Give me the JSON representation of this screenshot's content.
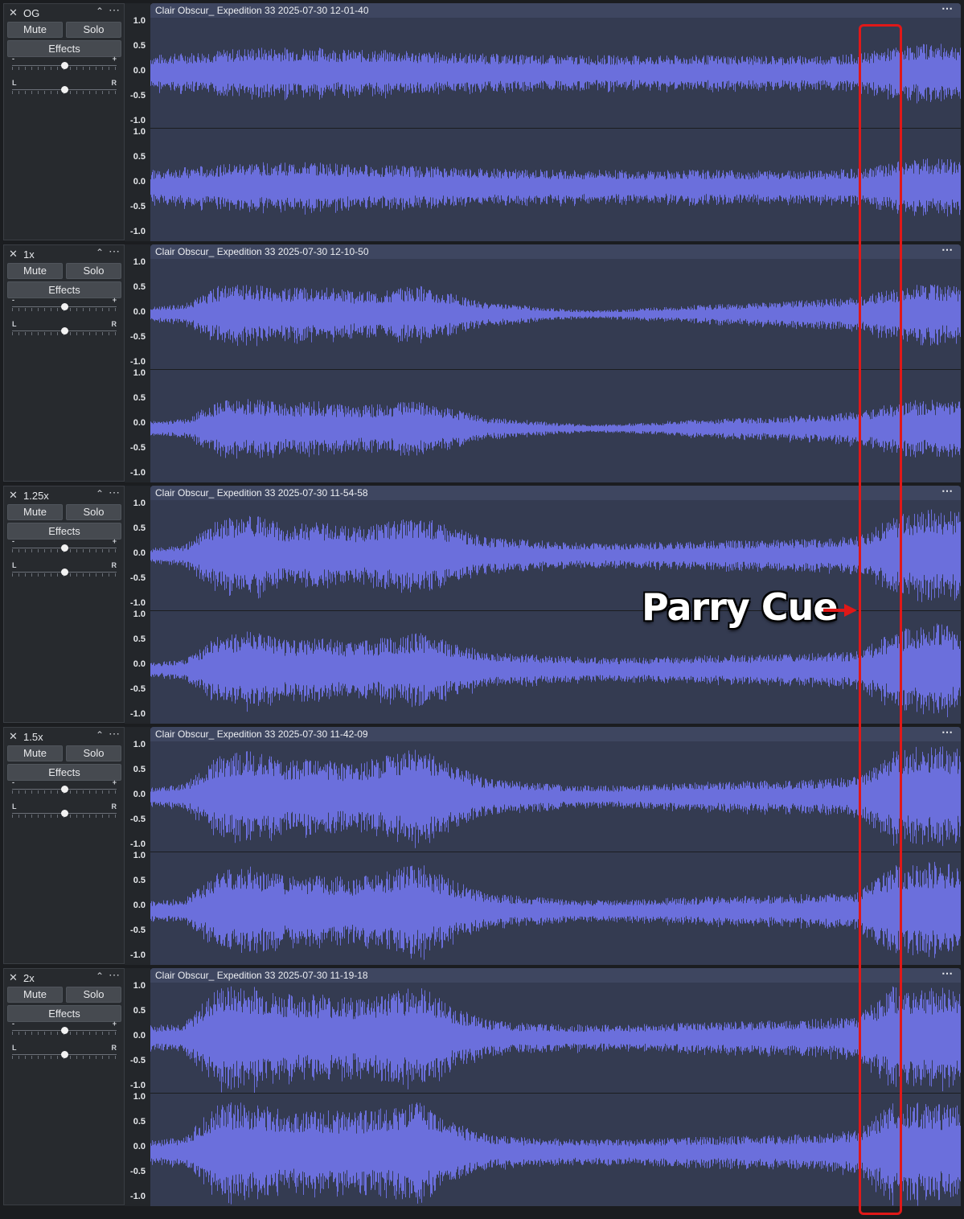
{
  "tracks": [
    {
      "name": "OG",
      "mute_label": "Mute",
      "solo_label": "Solo",
      "effects_label": "Effects",
      "gain_min": "-",
      "gain_max": "+",
      "pan_left": "L",
      "pan_right": "R",
      "clip_title": "Clair Obscur_ Expedition 33 2025-07-30 12-01-40",
      "envelope": [
        0.35,
        0.4,
        0.45,
        0.5,
        0.5,
        0.5,
        0.45,
        0.45,
        0.42,
        0.4,
        0.38,
        0.36,
        0.35,
        0.35,
        0.35,
        0.34,
        0.35,
        0.35,
        0.34,
        0.34,
        0.35,
        0.38,
        0.5,
        0.58,
        0.55
      ]
    },
    {
      "name": "1x",
      "mute_label": "Mute",
      "solo_label": "Solo",
      "effects_label": "Effects",
      "gain_min": "-",
      "gain_max": "+",
      "pan_left": "L",
      "pan_right": "R",
      "clip_title": "Clair Obscur_ Expedition 33 2025-07-30 12-10-50",
      "envelope": [
        0.15,
        0.2,
        0.55,
        0.6,
        0.5,
        0.55,
        0.45,
        0.5,
        0.55,
        0.4,
        0.22,
        0.18,
        0.12,
        0.08,
        0.1,
        0.14,
        0.18,
        0.2,
        0.22,
        0.26,
        0.3,
        0.35,
        0.5,
        0.6,
        0.55
      ]
    },
    {
      "name": "1.25x",
      "mute_label": "Mute",
      "solo_label": "Solo",
      "effects_label": "Effects",
      "gain_min": "-",
      "gain_max": "+",
      "pan_left": "L",
      "pan_right": "R",
      "clip_title": "Clair Obscur_ Expedition 33 2025-07-30 11-54-58",
      "envelope": [
        0.15,
        0.2,
        0.7,
        0.8,
        0.6,
        0.65,
        0.55,
        0.65,
        0.75,
        0.55,
        0.35,
        0.32,
        0.28,
        0.25,
        0.24,
        0.26,
        0.28,
        0.3,
        0.3,
        0.32,
        0.34,
        0.38,
        0.75,
        0.95,
        0.85
      ]
    },
    {
      "name": "1.5x",
      "mute_label": "Mute",
      "solo_label": "Solo",
      "effects_label": "Effects",
      "gain_min": "-",
      "gain_max": "+",
      "pan_left": "L",
      "pan_right": "R",
      "clip_title": "Clair Obscur_ Expedition 33 2025-07-30 11-42-09",
      "envelope": [
        0.2,
        0.25,
        0.8,
        0.9,
        0.7,
        0.75,
        0.65,
        0.8,
        0.95,
        0.6,
        0.35,
        0.3,
        0.25,
        0.22,
        0.22,
        0.25,
        0.28,
        0.3,
        0.32,
        0.33,
        0.35,
        0.4,
        0.9,
        1.0,
        0.95
      ]
    },
    {
      "name": "2x",
      "mute_label": "Mute",
      "solo_label": "Solo",
      "effects_label": "Effects",
      "gain_min": "-",
      "gain_max": "+",
      "pan_left": "L",
      "pan_right": "R",
      "clip_title": "Clair Obscur_ Expedition 33 2025-07-30 11-19-18",
      "envelope": [
        0.25,
        0.3,
        1.0,
        1.0,
        0.85,
        0.85,
        0.8,
        0.9,
        1.0,
        0.6,
        0.35,
        0.3,
        0.28,
        0.26,
        0.26,
        0.28,
        0.3,
        0.32,
        0.33,
        0.35,
        0.38,
        0.45,
        1.0,
        1.0,
        0.95
      ]
    }
  ],
  "scale_ticks": [
    "1.0",
    "0.5",
    "0.0",
    "-0.5",
    "-1.0"
  ],
  "annotation": {
    "label": "Parry Cue",
    "color": "#e01818"
  },
  "colors": {
    "waveform": "#6b6fdc",
    "clip_bg": "#343b51",
    "clip_header": "#3e4660"
  }
}
